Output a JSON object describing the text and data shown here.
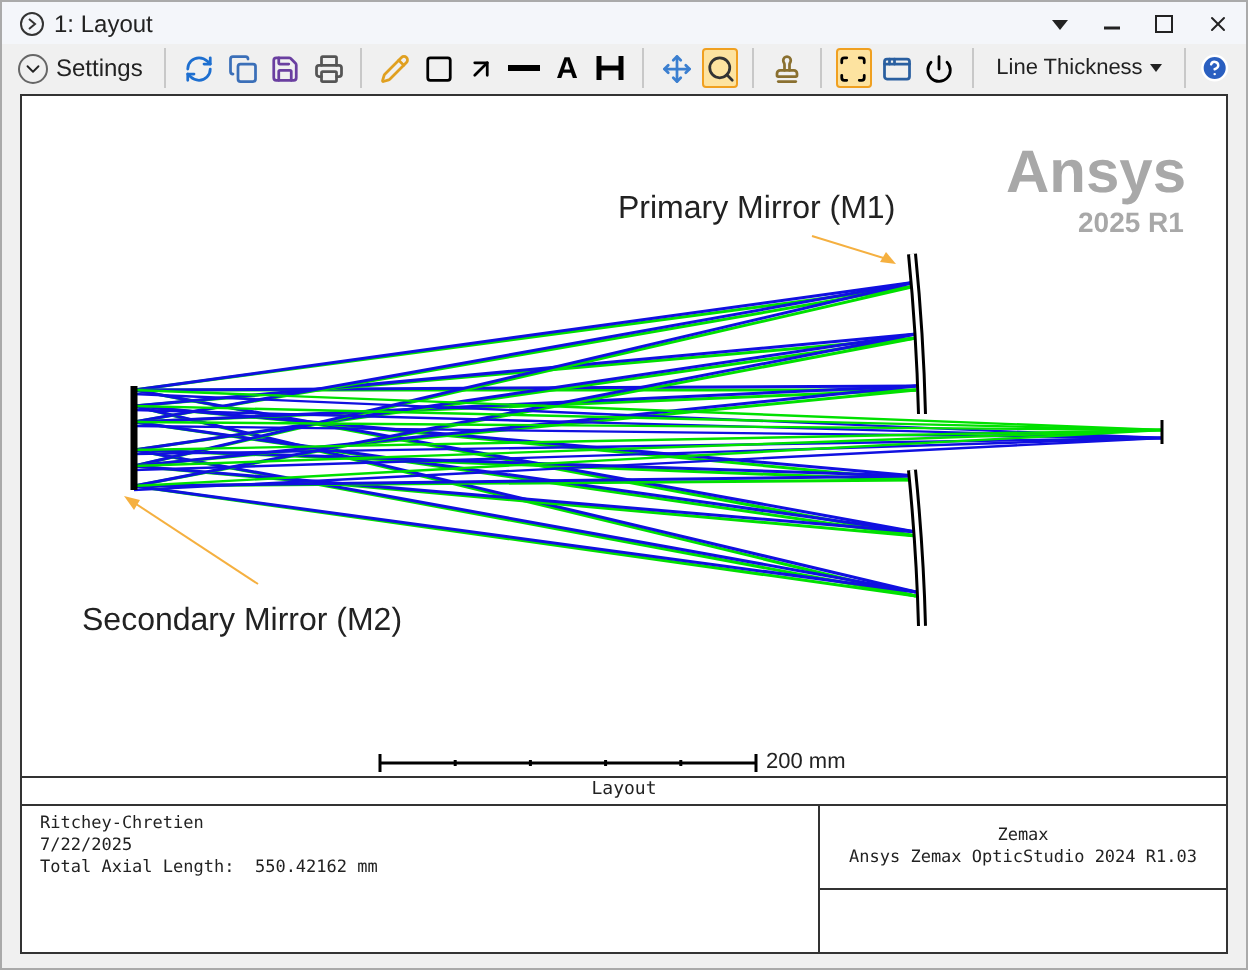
{
  "window": {
    "title": "1: Layout"
  },
  "toolbar": {
    "settings_label": "Settings",
    "tools": [
      {
        "kind": "refresh",
        "selected": false
      },
      {
        "kind": "copy",
        "selected": false
      },
      {
        "kind": "save",
        "selected": false
      },
      {
        "kind": "print",
        "selected": false
      },
      {
        "kind": "sep"
      },
      {
        "kind": "pencil",
        "selected": false
      },
      {
        "kind": "rectangle",
        "selected": false
      },
      {
        "kind": "arrow",
        "selected": false
      },
      {
        "kind": "line",
        "selected": false
      },
      {
        "kind": "text",
        "label": "A",
        "selected": false
      },
      {
        "kind": "dimension",
        "selected": false
      },
      {
        "kind": "sep"
      },
      {
        "kind": "pan",
        "selected": false
      },
      {
        "kind": "zoom",
        "selected": true
      },
      {
        "kind": "sep"
      },
      {
        "kind": "stamp",
        "selected": false
      },
      {
        "kind": "sep"
      },
      {
        "kind": "fit",
        "selected": true
      },
      {
        "kind": "windows",
        "selected": false
      },
      {
        "kind": "power",
        "selected": false
      }
    ],
    "line_thickness": "Line Thickness"
  },
  "plot": {
    "watermark": {
      "brand": "Ansys",
      "version": "2025 R1"
    },
    "annotations": [
      {
        "kind": "primary",
        "text": "Primary Mirror (M1)"
      },
      {
        "kind": "secondary",
        "text": "Secondary Mirror (M2)"
      }
    ],
    "scale_label": "200 mm"
  },
  "info": {
    "title": "Layout",
    "lines": [
      "Ritchey-Chretien",
      "7/22/2025",
      "Total Axial Length:  550.42162 mm"
    ],
    "right_lines": [
      "Zemax",
      "Ansys Zemax OpticStudio 2024 R1.03"
    ]
  }
}
